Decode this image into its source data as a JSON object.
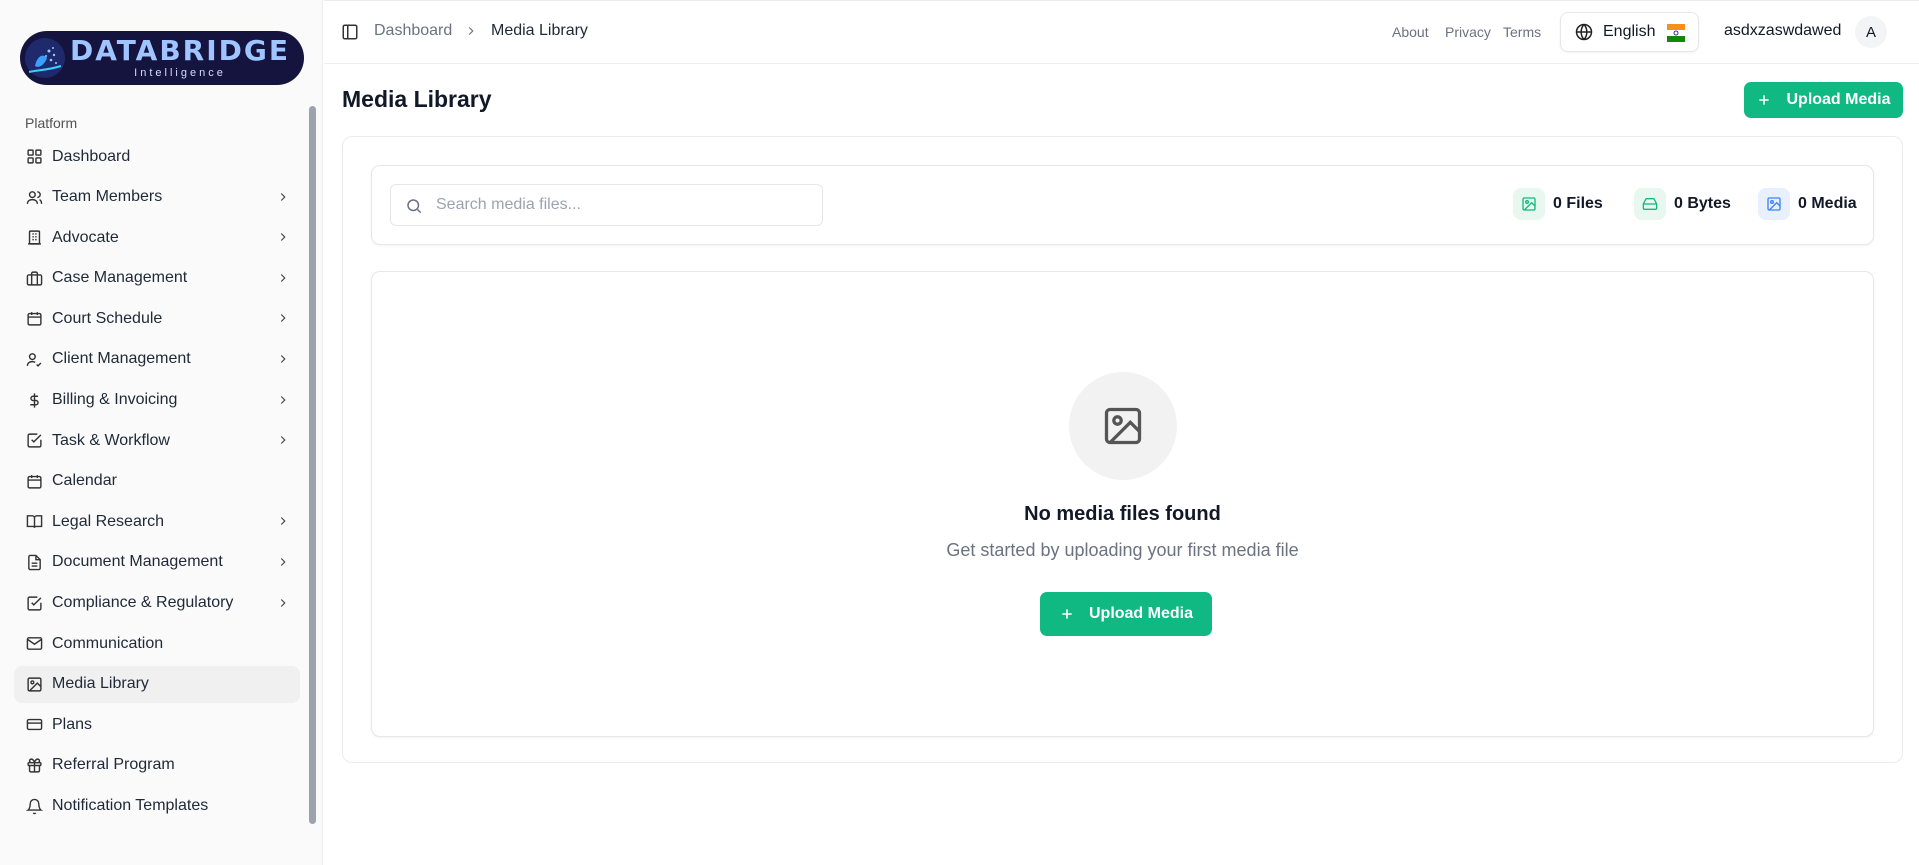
{
  "brand": {
    "name": "DATABRIDGE",
    "tagline": "Intelligence"
  },
  "sidebar": {
    "section_label": "Platform",
    "items": [
      {
        "label": "Dashboard",
        "icon": "dashboard-icon",
        "has_children": false
      },
      {
        "label": "Team Members",
        "icon": "users-icon",
        "has_children": true
      },
      {
        "label": "Advocate",
        "icon": "building-icon",
        "has_children": true
      },
      {
        "label": "Case Management",
        "icon": "briefcase-icon",
        "has_children": true
      },
      {
        "label": "Court Schedule",
        "icon": "calendar-icon",
        "has_children": true
      },
      {
        "label": "Client Management",
        "icon": "user-check-icon",
        "has_children": true
      },
      {
        "label": "Billing & Invoicing",
        "icon": "dollar-icon",
        "has_children": true
      },
      {
        "label": "Task & Workflow",
        "icon": "check-square-icon",
        "has_children": true
      },
      {
        "label": "Calendar",
        "icon": "calendar-days-icon",
        "has_children": false
      },
      {
        "label": "Legal Research",
        "icon": "book-icon",
        "has_children": true
      },
      {
        "label": "Document Management",
        "icon": "file-icon",
        "has_children": true
      },
      {
        "label": "Compliance & Regulatory",
        "icon": "check-square-icon",
        "has_children": true
      },
      {
        "label": "Communication",
        "icon": "mail-icon",
        "has_children": false
      },
      {
        "label": "Media Library",
        "icon": "image-icon",
        "has_children": false,
        "active": true
      },
      {
        "label": "Plans",
        "icon": "credit-card-icon",
        "has_children": false
      },
      {
        "label": "Referral Program",
        "icon": "gift-icon",
        "has_children": false
      },
      {
        "label": "Notification Templates",
        "icon": "bell-icon",
        "has_children": false
      }
    ]
  },
  "header": {
    "breadcrumb": [
      "Dashboard",
      "Media Library"
    ],
    "links": [
      "About",
      "Privacy",
      "Terms"
    ],
    "language": "English",
    "username": "asdxzaswdawed",
    "avatar_initial": "A"
  },
  "main": {
    "title": "Media Library",
    "upload_label": "Upload Media",
    "search_placeholder": "Search media files...",
    "stats": {
      "files": "0 Files",
      "bytes": "0 Bytes",
      "media": "0 Media"
    },
    "empty": {
      "title": "No media files found",
      "subtitle": "Get started by uploading your first media file",
      "button_label": "Upload Media"
    }
  },
  "colors": {
    "accent": "#10b981",
    "brand_bg": "#14143f",
    "stat_files": "#10b981",
    "stat_bytes": "#10b981",
    "stat_media": "#3b82f6"
  }
}
